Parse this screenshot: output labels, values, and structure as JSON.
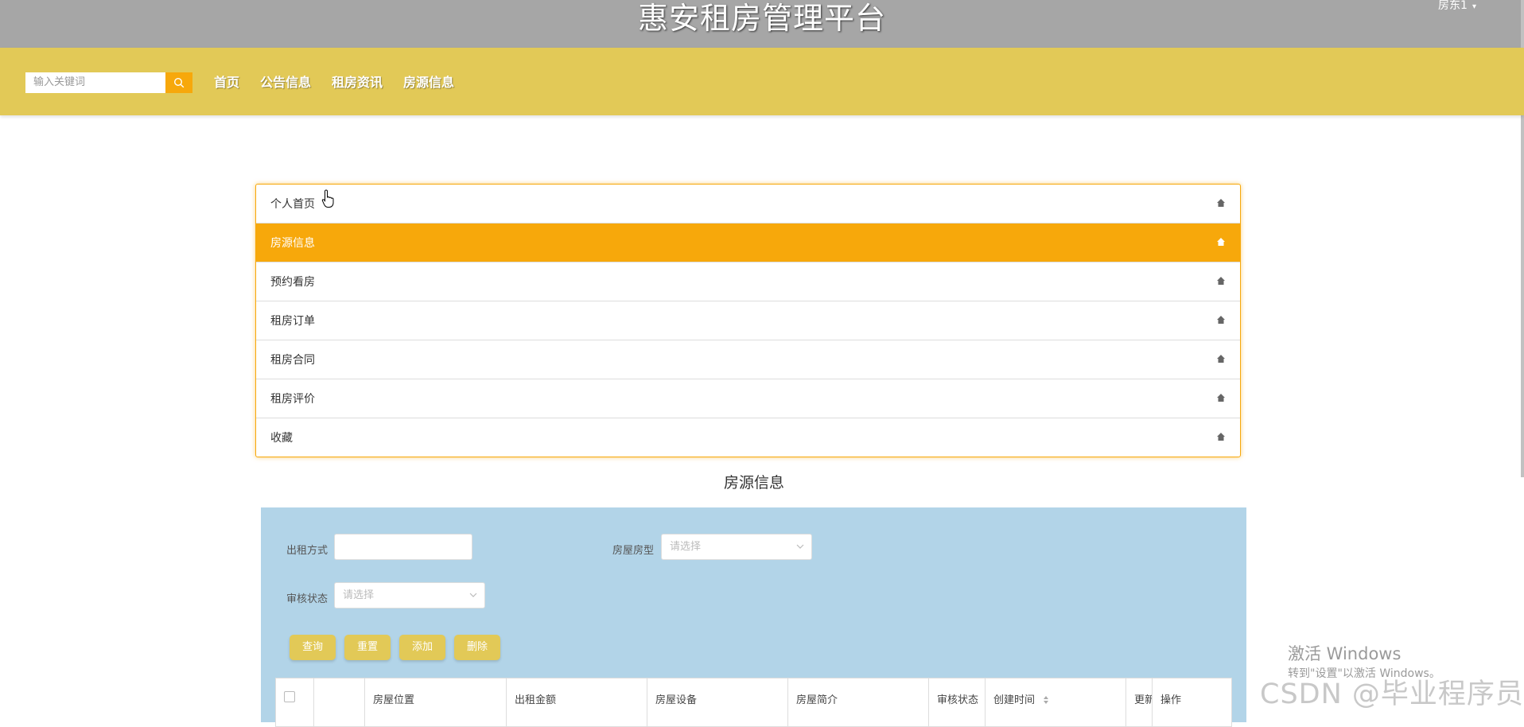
{
  "header": {
    "title": "惠安租房管理平台",
    "user_label": "房东1"
  },
  "navbar": {
    "search_placeholder": "输入关键词",
    "links": [
      "首页",
      "公告信息",
      "租房资讯",
      "房源信息"
    ]
  },
  "menu": {
    "items": [
      {
        "label": "个人首页"
      },
      {
        "label": "房源信息"
      },
      {
        "label": "预约看房"
      },
      {
        "label": "租房订单"
      },
      {
        "label": "租房合同"
      },
      {
        "label": "租房评价"
      },
      {
        "label": "收藏"
      }
    ],
    "active_index": 1
  },
  "section_title": "房源信息",
  "filters": {
    "rent_type_label": "出租方式",
    "rent_type_value": "",
    "house_type_label": "房屋房型",
    "house_type_placeholder": "请选择",
    "audit_status_label": "审核状态",
    "audit_status_placeholder": "请选择"
  },
  "buttons": {
    "query": "查询",
    "reset": "重置",
    "add": "添加",
    "delete": "删除"
  },
  "table": {
    "columns": [
      "",
      "",
      "房屋位置",
      "出租金额",
      "房屋设备",
      "房屋简介",
      "审核状态",
      "创建时间",
      "更新",
      "操作"
    ]
  },
  "watermark": {
    "line1": "激活 Windows",
    "line2": "转到\"设置\"以激活 Windows。",
    "csdn": "CSDN @毕业程序员"
  },
  "colors": {
    "accent": "#f7a80b",
    "navbar": "#e2c957",
    "topbar": "#a6a6a6",
    "panel": "#b2d4e8"
  }
}
